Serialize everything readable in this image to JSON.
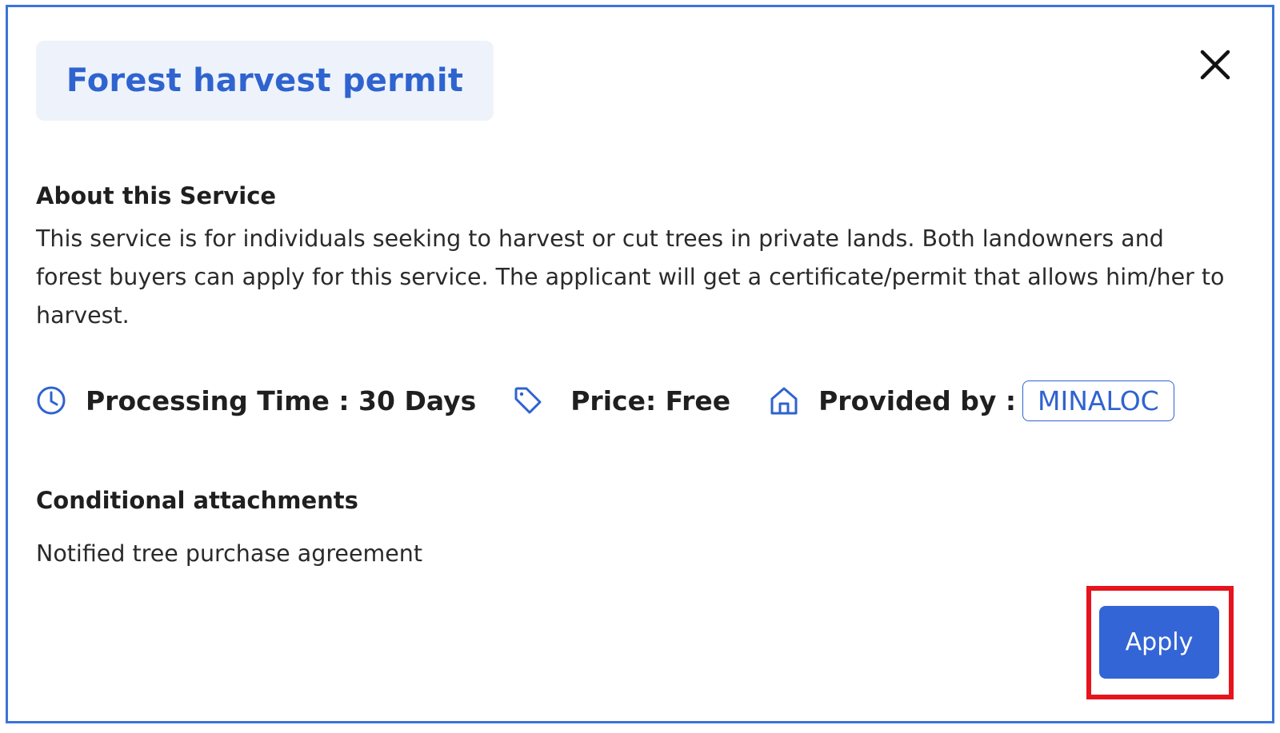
{
  "dialog": {
    "title": "Forest harvest permit",
    "close_icon": "close-icon"
  },
  "about": {
    "heading": "About this Service",
    "description": "This service is for individuals seeking to harvest or cut trees in private lands. Both landowners and forest buyers can apply for this service. The applicant will get a certificate/permit that allows him/her to harvest."
  },
  "meta": {
    "processing_time": {
      "icon": "clock-icon",
      "label": "Processing Time : 30 Days"
    },
    "price": {
      "icon": "tag-icon",
      "label": "Price: Free"
    },
    "provider": {
      "icon": "home-icon",
      "label": "Provided by :",
      "value": "MINALOC"
    }
  },
  "attachments": {
    "heading": "Conditional attachments",
    "items": [
      "Notified tree purchase agreement"
    ]
  },
  "actions": {
    "apply_label": "Apply"
  },
  "colors": {
    "accent": "#2f63cf",
    "title_bg": "#eef3fb",
    "frame_border": "#3b73d9",
    "highlight": "#e6141d",
    "button_bg": "#3365d6"
  }
}
